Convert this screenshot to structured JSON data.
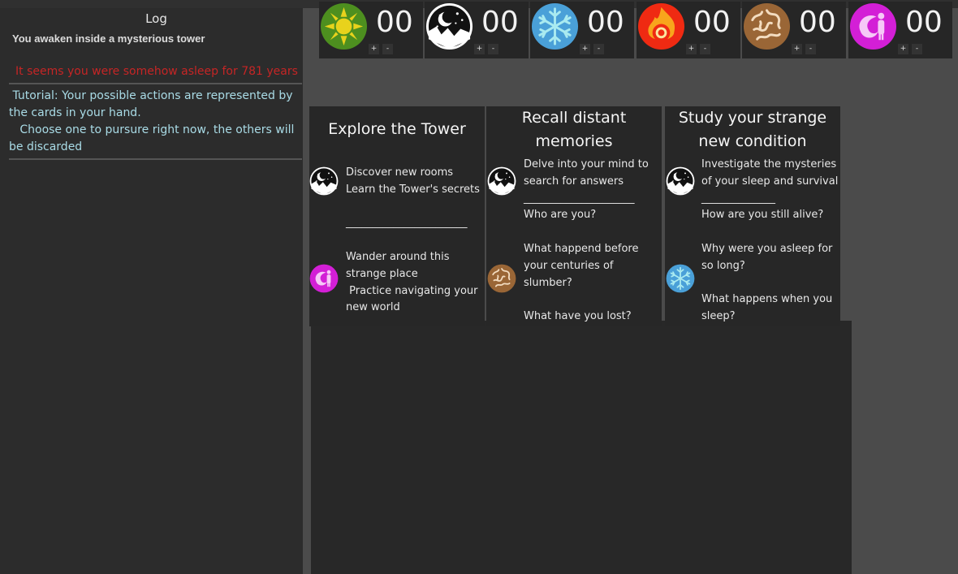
{
  "log": {
    "title": "Log",
    "entries": [
      "You awaken inside a mysterious tower",
      "It seems you were somehow asleep for 781 years",
      " Tutorial: Your possible actions are represented by the cards in your hand.\n   Choose one to pursure right now, the others will be discarded"
    ]
  },
  "resources": [
    {
      "icon": "sun-icon",
      "count": "00",
      "plus": "+",
      "minus": "-"
    },
    {
      "icon": "moon-night-icon",
      "count": "00",
      "plus": "+",
      "minus": "-"
    },
    {
      "icon": "snowflake-icon",
      "count": "00",
      "plus": "+",
      "minus": "-"
    },
    {
      "icon": "fire-icon",
      "count": "00",
      "plus": "+",
      "minus": "-"
    },
    {
      "icon": "brain-icon",
      "count": "00",
      "plus": "+",
      "minus": "-"
    },
    {
      "icon": "spirit-figure-icon",
      "count": "00",
      "plus": "+",
      "minus": "-"
    }
  ],
  "cards": [
    {
      "title": "Explore the Tower",
      "blocks": [
        {
          "icon": "moon-night-icon",
          "text": "Discover new rooms\nLearn the Tower's secrets\n\n_______________________"
        },
        {
          "icon": "spirit-figure-icon",
          "text": "Wander around this\nstrange place\n Practice navigating your\nnew world"
        }
      ]
    },
    {
      "title": "Recall distant\nmemories",
      "blocks": [
        {
          "icon": "moon-night-icon",
          "text": "Delve into your mind to\nsearch for answers\n_____________________\nWho are you?"
        },
        {
          "icon": "brain-icon",
          "text": "What happend before\nyour centuries of\nslumber?\n\nWhat have you lost?"
        }
      ]
    },
    {
      "title": "Study your strange\nnew condition",
      "blocks": [
        {
          "icon": "moon-night-icon",
          "text": "Investigate the mysteries\nof your sleep and survival\n______________\nHow are you still alive?"
        },
        {
          "icon": "snowflake-icon",
          "text": "Why were you asleep for\nso long?\n\nWhat happens when you\nsleep?"
        }
      ]
    }
  ],
  "colors": {
    "sun": "#e3c71e",
    "moon": "#111111",
    "snowflake": "#4aa0d8",
    "fire": "#f23a10",
    "brain": "#9a6636",
    "spirit": "#d31fd6",
    "asleep_text": "#c62525",
    "tutorial_text": "#a9dbe6"
  }
}
